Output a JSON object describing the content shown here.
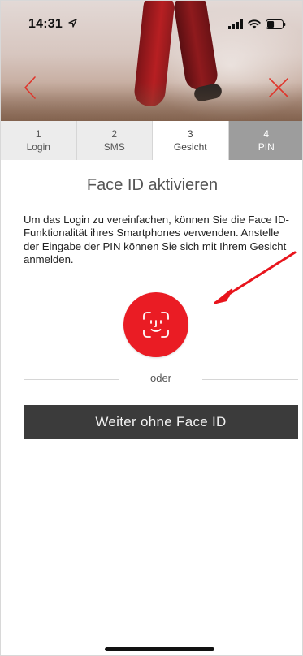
{
  "status_bar": {
    "time": "14:31",
    "location_icon": "location-arrow-icon",
    "signal_icon": "signal-icon",
    "wifi_icon": "wifi-icon",
    "battery_icon": "battery-icon",
    "battery_level": 0.45
  },
  "header": {
    "back_icon": "chevron-left-icon",
    "close_icon": "close-icon",
    "accent_color": "#ea1c24"
  },
  "steps": [
    {
      "number": "1",
      "label": "Login",
      "state": "done"
    },
    {
      "number": "2",
      "label": "SMS",
      "state": "done"
    },
    {
      "number": "3",
      "label": "Gesicht",
      "state": "active"
    },
    {
      "number": "4",
      "label": "PIN",
      "state": "pending"
    }
  ],
  "main": {
    "title": "Face ID aktivieren",
    "description": "Um das Login zu vereinfachen, können Sie die Face ID-Funktionalität ihres Smartphones verwenden. Anstelle der Eingabe der PIN können Sie sich mit Ihrem Gesicht anmelden.",
    "faceid_icon": "face-id-icon",
    "faceid_color": "#ea1c24",
    "annotation_icon": "red-arrow-icon",
    "divider_text": "oder",
    "skip_button_label": "Weiter ohne Face ID",
    "skip_button_color": "#3b3b3b"
  }
}
